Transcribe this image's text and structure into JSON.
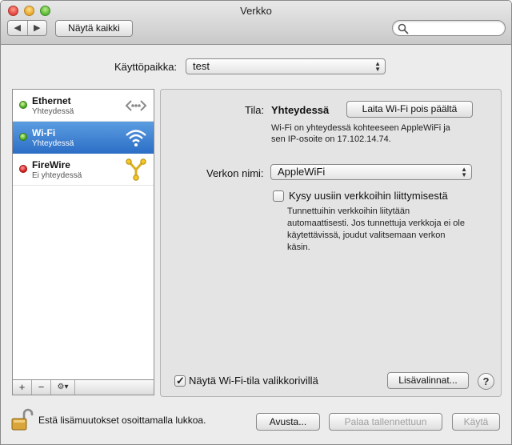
{
  "window": {
    "title": "Verkko"
  },
  "toolbar": {
    "back_glyph": "◀",
    "forward_glyph": "▶",
    "show_all_label": "Näytä kaikki",
    "search_placeholder": "",
    "search_icon": "magnifier-icon"
  },
  "location": {
    "label": "Käyttöpaikka:",
    "value": "test"
  },
  "services": [
    {
      "name": "Ethernet",
      "status": "Yhteydessä",
      "status_color": "green",
      "icon": "ethernet-icon",
      "selected": false
    },
    {
      "name": "Wi-Fi",
      "status": "Yhteydessä",
      "status_color": "green",
      "icon": "wifi-icon",
      "selected": true
    },
    {
      "name": "FireWire",
      "status": "Ei yhteydessä",
      "status_color": "red",
      "icon": "firewire-icon",
      "selected": false
    }
  ],
  "sidebar_tools": {
    "add": "+",
    "remove": "−",
    "action": "⚙▾"
  },
  "detail": {
    "status_label": "Tila:",
    "status_value": "Yhteydessä",
    "toggle_button": "Laita Wi-Fi pois päältä",
    "status_desc_1": "Wi-Fi on yhteydessä kohteeseen AppleWiFi ja",
    "status_desc_2": "sen IP-osoite on 17.102.14.74.",
    "network_name_label": "Verkon nimi:",
    "network_name_value": "AppleWiFi",
    "ask_join_label": "Kysy uusiin verkkoihin liittymisestä",
    "ask_join_checked": false,
    "ask_desc_1": "Tunnettuihin verkkoihin liitytään",
    "ask_desc_2": "automaattisesti. Jos tunnettuja verkkoja ei ole",
    "ask_desc_3": "käytettävissä, joudut valitsemaan verkon",
    "ask_desc_4": "käsin.",
    "show_menu_label": "Näytä Wi-Fi-tila valikkorivillä",
    "show_menu_checked": true,
    "advanced_button": "Lisävalinnat...",
    "help_glyph": "?"
  },
  "footer": {
    "lock_text": "Estä lisämuutokset osoittamalla lukkoa.",
    "assist_button": "Avusta...",
    "revert_button": "Palaa tallennettuun",
    "apply_button": "Käytä"
  },
  "colors": {
    "selection": "#2d6fc6",
    "connected": "#3fa31b",
    "disconnected": "#d01414"
  }
}
